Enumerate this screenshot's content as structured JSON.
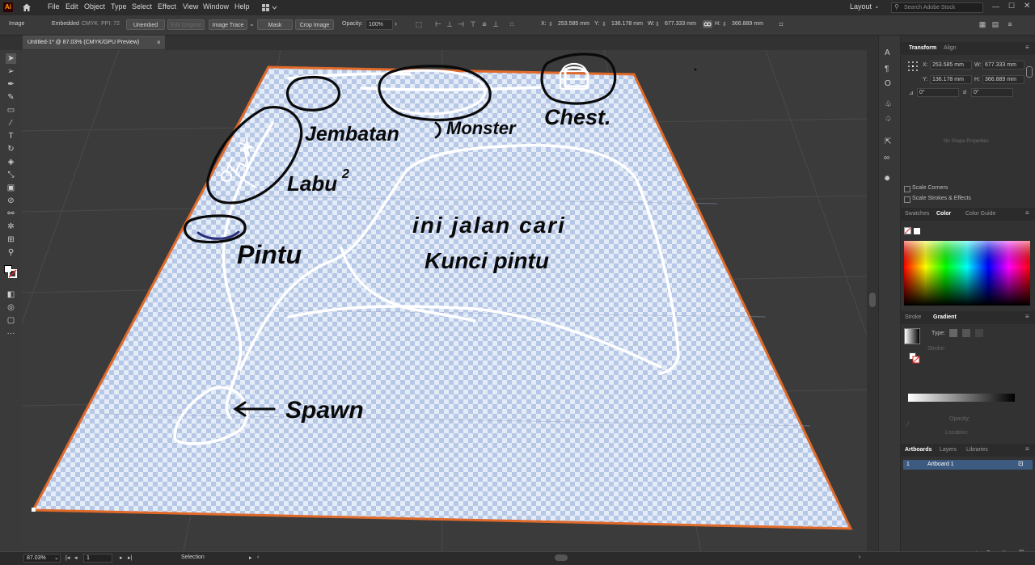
{
  "app": {
    "logo": "Ai"
  },
  "menu": [
    "File",
    "Edit",
    "Object",
    "Type",
    "Select",
    "Effect",
    "View",
    "Window",
    "Help"
  ],
  "workspace": {
    "layout_label": "Layout",
    "search_placeholder": "Search Adobe Stock"
  },
  "control": {
    "object_type": "Image",
    "embedded": "Embedded",
    "color_mode": "CMYK",
    "ppi": "PPI: 72",
    "unembed": "Unembed",
    "edit_original": "Edit Original",
    "image_trace": "Image Trace",
    "mask": "Mask",
    "crop_image": "Crop Image",
    "opacity_label": "Opacity:",
    "opacity_value": "100%",
    "x_label": "X:",
    "x_value": "253.585 mm",
    "y_label": "Y:",
    "y_value": "136.178 mm",
    "w_label": "W:",
    "w_value": "677.333 mm",
    "h_label": "H:",
    "h_value": "366.889 mm"
  },
  "document": {
    "tab_title": "Untitled-1* @ 87.03% (CMYK/GPU Preview)",
    "close": "×"
  },
  "sketch_labels": {
    "jembatan": "Jembatan",
    "monster": "Monster",
    "chest": "Chest.",
    "labu": "Labu",
    "labu_sup": "2",
    "pintu": "Pintu",
    "path_note_1": "ini jalan cari",
    "path_note_2": "Kunci pintu",
    "spawn": "Spawn"
  },
  "colors": {
    "artboard_border": "#e06a2a",
    "checker_light": "#e4ecf8",
    "checker_dark": "#b7c7e6",
    "sketch_black": "#0a0a0a",
    "sketch_white": "#ffffff",
    "door_arc": "#2a2f7a"
  },
  "panels": {
    "transform_tab": "Transform",
    "align_tab": "Align",
    "x_label": "X:",
    "x_value": "253.585 mm",
    "y_label": "Y:",
    "y_value": "136.178 mm",
    "w_label": "W:",
    "w_value": "677.333 mm",
    "h_label": "H:",
    "h_value": "366.889 mm",
    "rotate_value": "0°",
    "shear_value": "0°",
    "no_shape": "No Shape Properties",
    "scale_corners": "Scale Corners",
    "scale_strokes": "Scale Strokes & Effects",
    "swatches_tab": "Swatches",
    "color_tab": "Color",
    "color_guide_tab": "Color Guide",
    "stroke_tab": "Stroke",
    "gradient_tab": "Gradient",
    "type_label": "Type:",
    "stroke_label": "Stroke:",
    "opacity_label": "Opacity:",
    "location_label": "Location:",
    "artboards_tab": "Artboards",
    "layers_tab": "Layers",
    "libraries_tab": "Libraries",
    "artboard_index": "1",
    "artboard_name": "Artboard 1"
  },
  "status": {
    "zoom": "87.03%",
    "artboard_num": "1",
    "tool": "Selection"
  }
}
